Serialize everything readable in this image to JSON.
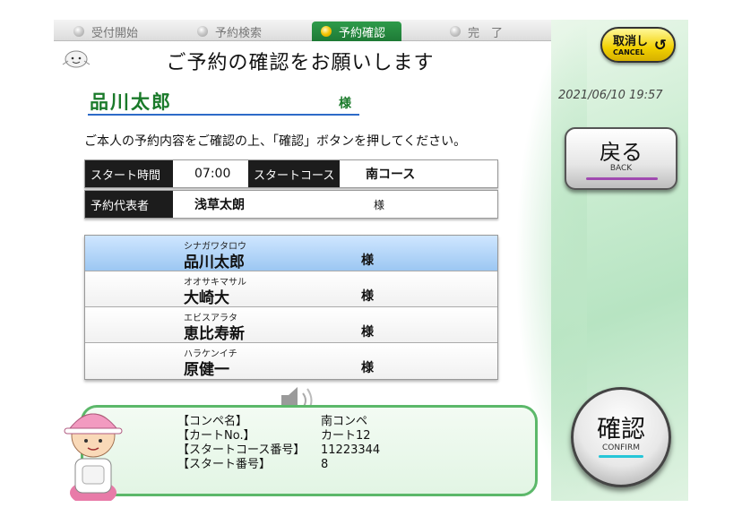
{
  "steps": [
    {
      "label": "受付開始",
      "active": false
    },
    {
      "label": "予約検索",
      "active": false
    },
    {
      "label": "予約確認",
      "active": true
    },
    {
      "label": "完　了",
      "active": false
    }
  ],
  "title": "ご予約の確認をお願いします",
  "customer": {
    "name": "品川太郎",
    "honorific": "様"
  },
  "instruction": "ご本人の予約内容をご確認の上、「確認」ボタンを押してください。",
  "reservation": {
    "start_time_label": "スタート時間",
    "start_time": "07:00",
    "start_course_label": "スタートコース",
    "start_course": "南コース",
    "representative_label": "予約代表者",
    "representative": "浅草太朗",
    "representative_honorific": "様"
  },
  "members": [
    {
      "kana": "シナガワタロウ",
      "name": "品川太郎",
      "honorific": "様",
      "selected": true
    },
    {
      "kana": "オオサキマサル",
      "name": "大崎大",
      "honorific": "様",
      "selected": false
    },
    {
      "kana": "エビスアラタ",
      "name": "恵比寿新",
      "honorific": "様",
      "selected": false
    },
    {
      "kana": "ハラケンイチ",
      "name": "原健一",
      "honorific": "様",
      "selected": false
    }
  ],
  "competition": {
    "rows": [
      {
        "key": "【コンペ名】",
        "value": "南コンペ"
      },
      {
        "key": "【カートNo.】",
        "value": "カート12"
      },
      {
        "key": "【スタートコース番号】",
        "value": "11223344"
      },
      {
        "key": "【スタート番号】",
        "value": "8"
      }
    ]
  },
  "cancel_button": {
    "label": "取消し",
    "sub": "CANCEL",
    "icon": "undo-icon"
  },
  "datetime": "2021/06/10 19:57",
  "back_button": {
    "label": "戻る",
    "sub": "BACK"
  },
  "confirm_button": {
    "label": "確認",
    "sub": "CONFIRM"
  },
  "colors": {
    "accent_green": "#1e7a36",
    "selected_row": "#9cc7f2",
    "cancel_yellow": "#f2d000"
  }
}
